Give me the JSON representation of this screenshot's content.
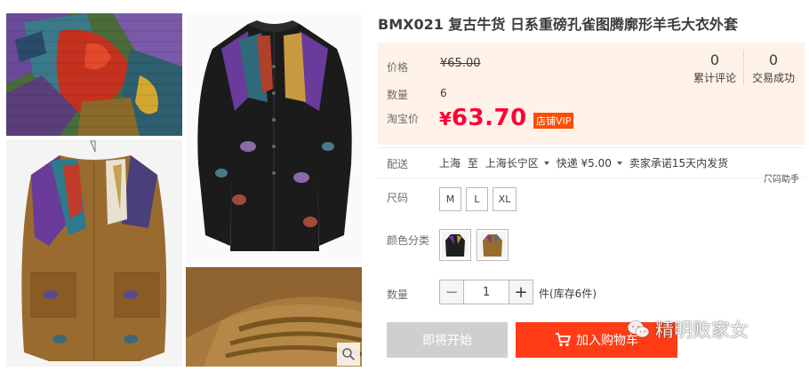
{
  "product": {
    "title": "BMX021 复古牛货 日系重磅孔雀图腾廓形羊毛大衣外套"
  },
  "price_box": {
    "price_label": "价格",
    "original_price": "¥65.00",
    "sales_label": "数量",
    "sales_value": "6",
    "taobao_price_label": "淘宝价",
    "currency": "¥",
    "sale_price": "63.70",
    "vip_badge": "店铺VIP",
    "reviews_count": "0",
    "reviews_label": "累计评论",
    "deals_count": "0",
    "deals_label": "交易成功"
  },
  "shipping": {
    "label": "配送",
    "from": "上海",
    "to_word": "至",
    "destination": "上海长宁区",
    "method": "快递 ¥5.00",
    "promise": "卖家承诺15天内发货"
  },
  "size": {
    "label": "尺码",
    "help": "尺码助手",
    "options": [
      "M",
      "L",
      "XL"
    ]
  },
  "color": {
    "label": "颜色分类",
    "options": [
      "black-coat",
      "brown-coat"
    ]
  },
  "quantity": {
    "label": "数量",
    "minus": "−",
    "value": "1",
    "plus": "+",
    "stock_text": "件(库存6件)"
  },
  "buttons": {
    "coming_soon": "即将开始",
    "add_to_cart": "加入购物车"
  },
  "watermark": {
    "text": "精明败家女"
  },
  "colors": {
    "price_red": "#ff0036",
    "cart_button": "#ff3c16",
    "vip_badge": "#ff4c00",
    "price_box_bg": "#fff2e8",
    "disabled_button": "#cfcfcf"
  }
}
